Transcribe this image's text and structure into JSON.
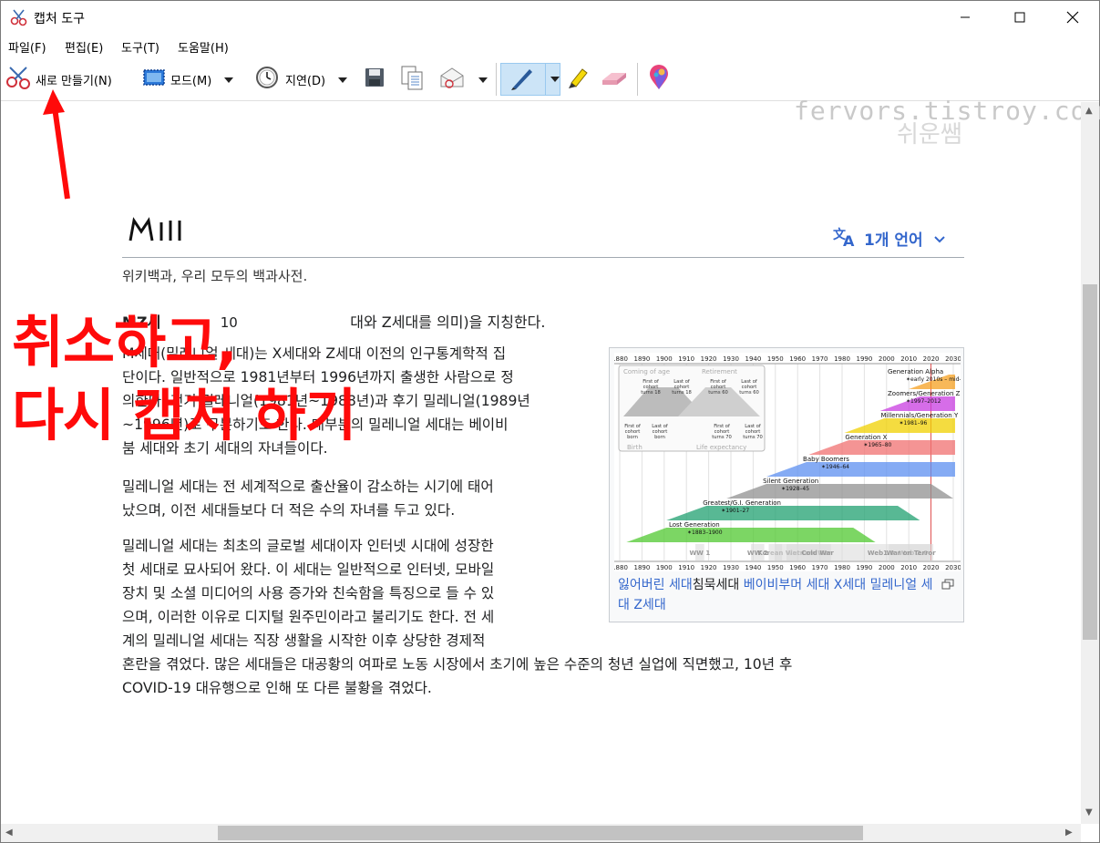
{
  "window": {
    "title": "캡처 도구",
    "title_icon": "scissors-icon"
  },
  "menu": [
    "파일(F)",
    "편집(E)",
    "도구(T)",
    "도움말(H)"
  ],
  "toolbar": {
    "new_label": "새로 만들기(N)",
    "mode_label": "모드(M)",
    "delay_label": "지연(D)"
  },
  "watermark": {
    "line1": "쉬운쌤",
    "line2": "fervors.tistroy.com"
  },
  "annotation": {
    "line1": "취소하고,",
    "line2": "다시 캡처 하기"
  },
  "article": {
    "language_button": "1개 언어",
    "subtitle": "위키백과, 우리 모두의 백과사전.",
    "intro_lead": "MZ세",
    "intro_mid": "10",
    "intro_tail": "대와 Z세대를 의미)을 지칭한다.",
    "paragraphs": [
      [
        "M세대(밀레니얼 세대)는 X세대와 Z세대 이전의 인구통계학적 집",
        "단이다. 일반적으로 1981년부터 1996년까지 출생한 사람으로 정",
        "의한다. 전기 밀레니얼(1981년~1988년)과 후기 밀레니얼(1989년",
        "~1996년)로 구분하기도 한다. 대부분의 밀레니얼 세대는 베이비",
        "붐 세대와 초기 세대의 자녀들이다."
      ],
      [
        "밀레니얼 세대는 전 세계적으로 출산율이 감소하는 시기에 태어",
        "났으며, 이전 세대들보다 더 적은 수의 자녀를 두고 있다."
      ],
      [
        "밀레니얼 세대는 최초의 글로벌 세대이자 인터넷 시대에 성장한",
        "첫 세대로 묘사되어 왔다. 이 세대는 일반적으로 인터넷, 모바일",
        "장치 및 소셜 미디어의 사용 증가와 친숙함을 특징으로 들 수 있",
        "으며, 이러한 이유로 디지털 원주민이라고 불리기도 한다. 전 세",
        "계의 밀레니얼 세대는 직장 생활을 시작한 이후 상당한 경제적",
        "혼란을 겪었다. 많은 세대들은 대공황의 여파로 노동 시장에서 초기에 높은 수준의 청년 실업에 직면했고, 10년 후",
        "COVID-19 대유행으로 인해 또 다른 불황을 겪었다."
      ]
    ],
    "figure": {
      "years": [
        "1880",
        "1890",
        "1900",
        "1910",
        "1920",
        "1930",
        "1940",
        "1950",
        "1960",
        "1970",
        "1980",
        "1990",
        "2000",
        "2010",
        "2020",
        "2030"
      ],
      "generations": [
        {
          "name": "Generation Alpha",
          "years": "✶early 2010s – mid-2020s",
          "color": "#f5a020"
        },
        {
          "name": "Zoomers/Generation Z",
          "years": "✶1997–2012",
          "color": "#c83ce0"
        },
        {
          "name": "Millennials/Generation Y",
          "years": "✶1981–96",
          "color": "#f0d000"
        },
        {
          "name": "Generation X",
          "years": "✶1965–80",
          "color": "#f07070"
        },
        {
          "name": "Baby Boomers",
          "years": "✶1946–64",
          "color": "#5c8ff0"
        },
        {
          "name": "Silent Generation",
          "years": "✶1928–45",
          "color": "#909090"
        },
        {
          "name": "Greatest/G.I. Generation",
          "years": "✶1901–27",
          "color": "#20a070"
        },
        {
          "name": "Lost Generation",
          "years": "✶1883–1900",
          "color": "#50c830"
        }
      ],
      "legend": {
        "coming_of_age": "Coming of age",
        "retirement": "Retirement",
        "first_cohort_18": "First of cohort turns 18",
        "last_cohort_18": "Last of cohort turns 18",
        "first_cohort_60": "First of cohort turns 60",
        "last_cohort_60": "Last of cohort turns 60",
        "first_born": "First of cohort born",
        "last_born": "Last of cohort born",
        "first_70": "First of cohort turns 70",
        "last_70": "Last of cohort turns 70",
        "birth": "Birth",
        "life_expectancy": "Life expectancy"
      },
      "events": [
        "WW 1",
        "WW 2",
        "Korean War",
        "Vietnam War",
        "Cold War",
        "Web1.0",
        "Web 2.0",
        "War on Terror"
      ],
      "caption_links": [
        "잃어버린 세대",
        "베이비부머 세대",
        "X세대",
        "밀레니얼 세대",
        "Z세대"
      ],
      "caption_plain": "침묵세대"
    }
  }
}
